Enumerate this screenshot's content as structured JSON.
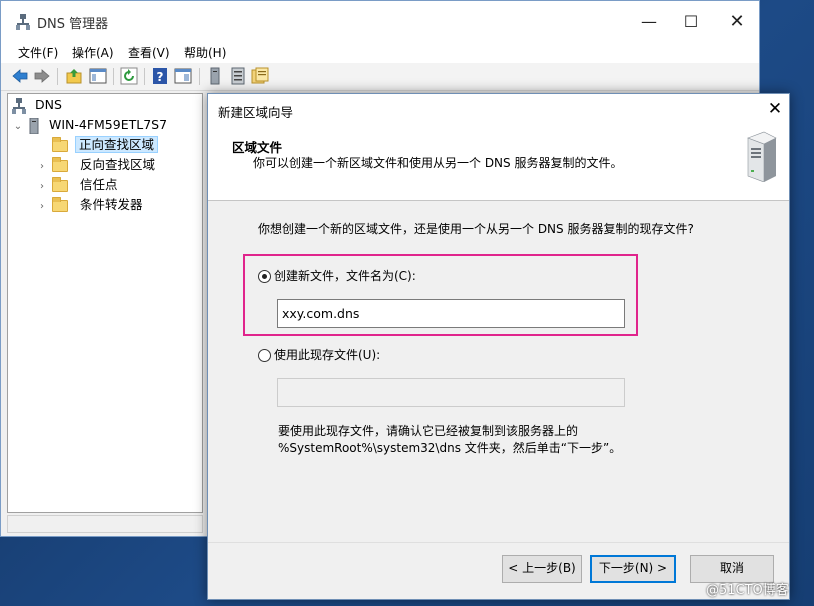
{
  "main_window": {
    "title": "DNS 管理器",
    "menu": [
      "文件(F)",
      "操作(A)",
      "查看(V)",
      "帮助(H)"
    ],
    "tree": {
      "root": "DNS",
      "server": "WIN-4FM59ETL7S7",
      "items": [
        "正向查找区域",
        "反向查找区域",
        "信任点",
        "条件转发器"
      ]
    }
  },
  "wizard": {
    "title": "新建区域向导",
    "header_title": "区域文件",
    "header_subtitle": "你可以创建一个新区域文件和使用从另一个 DNS 服务器复制的文件。",
    "question": "你想创建一个新的区域文件，还是使用一个从另一个 DNS 服务器复制的现存文件?",
    "option_new_label": "创建新文件，文件名为(C):",
    "option_new_value": "xxy.com.dns",
    "option_existing_label": "使用此现存文件(U):",
    "option_existing_value": "",
    "note_line1": "要使用此现存文件，请确认它已经被复制到该服务器上的",
    "note_line2": "%SystemRoot%\\system32\\dns 文件夹，然后单击“下一步”。",
    "btn_back": "< 上一步(B)",
    "btn_next": "下一步(N) >",
    "btn_cancel": "取消",
    "selected_option": "new"
  },
  "watermark": "@51CTO博客",
  "colors": {
    "highlight": "#e0248c",
    "selection": "#cce8ff",
    "default_button_border": "#0078d7"
  }
}
